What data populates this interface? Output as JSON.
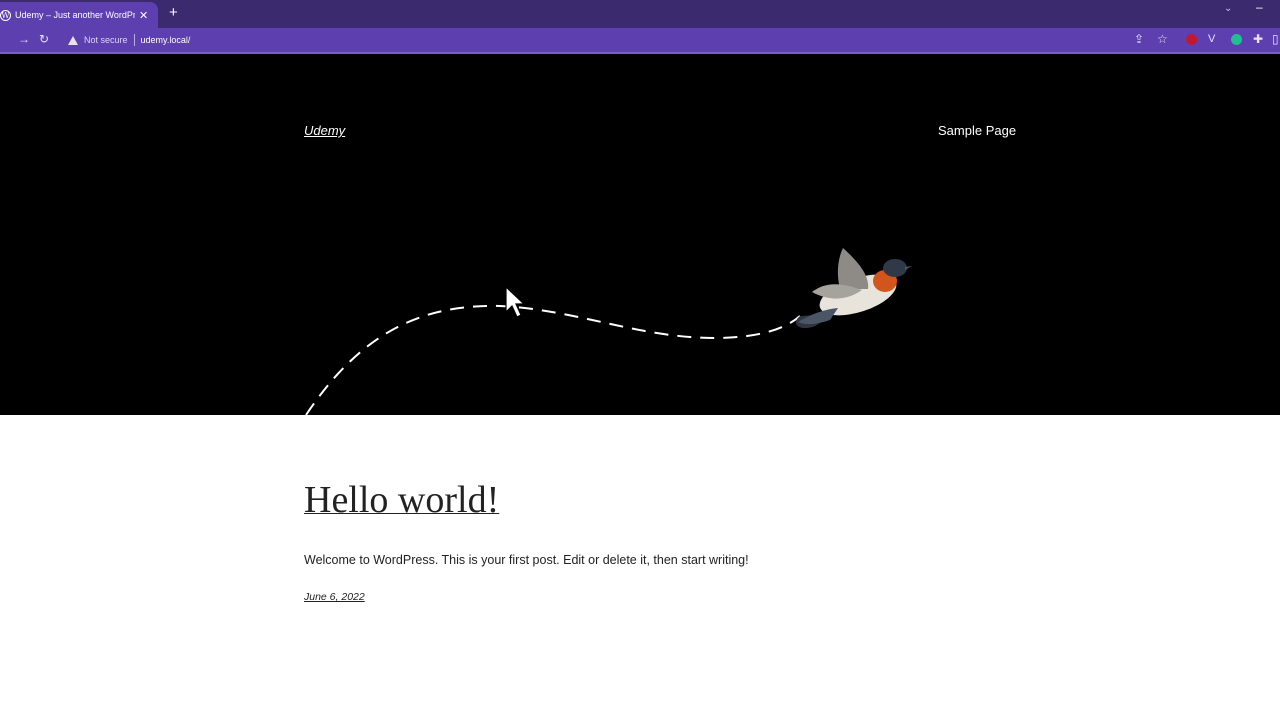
{
  "browser": {
    "tab_title": "Udemy – Just another WordPress",
    "address": {
      "security_label": "Not secure",
      "url": "udemy.local/"
    }
  },
  "site": {
    "title": "Udemy",
    "nav": [
      {
        "label": "Sample Page"
      }
    ]
  },
  "post": {
    "title": "Hello world!",
    "excerpt": "Welcome to WordPress. This is your first post. Edit or delete it, then start writing!",
    "date": "June 6, 2022"
  },
  "icons": {
    "tab_favicon": "wordpress-icon",
    "hero_image": "bird-illustration",
    "pointer": "mouse-cursor-icon"
  },
  "colors": {
    "tabbar": "#3b2a6e",
    "toolbar": "#5d3fb0",
    "hero_bg": "#000000",
    "page_bg": "#ffffff"
  }
}
